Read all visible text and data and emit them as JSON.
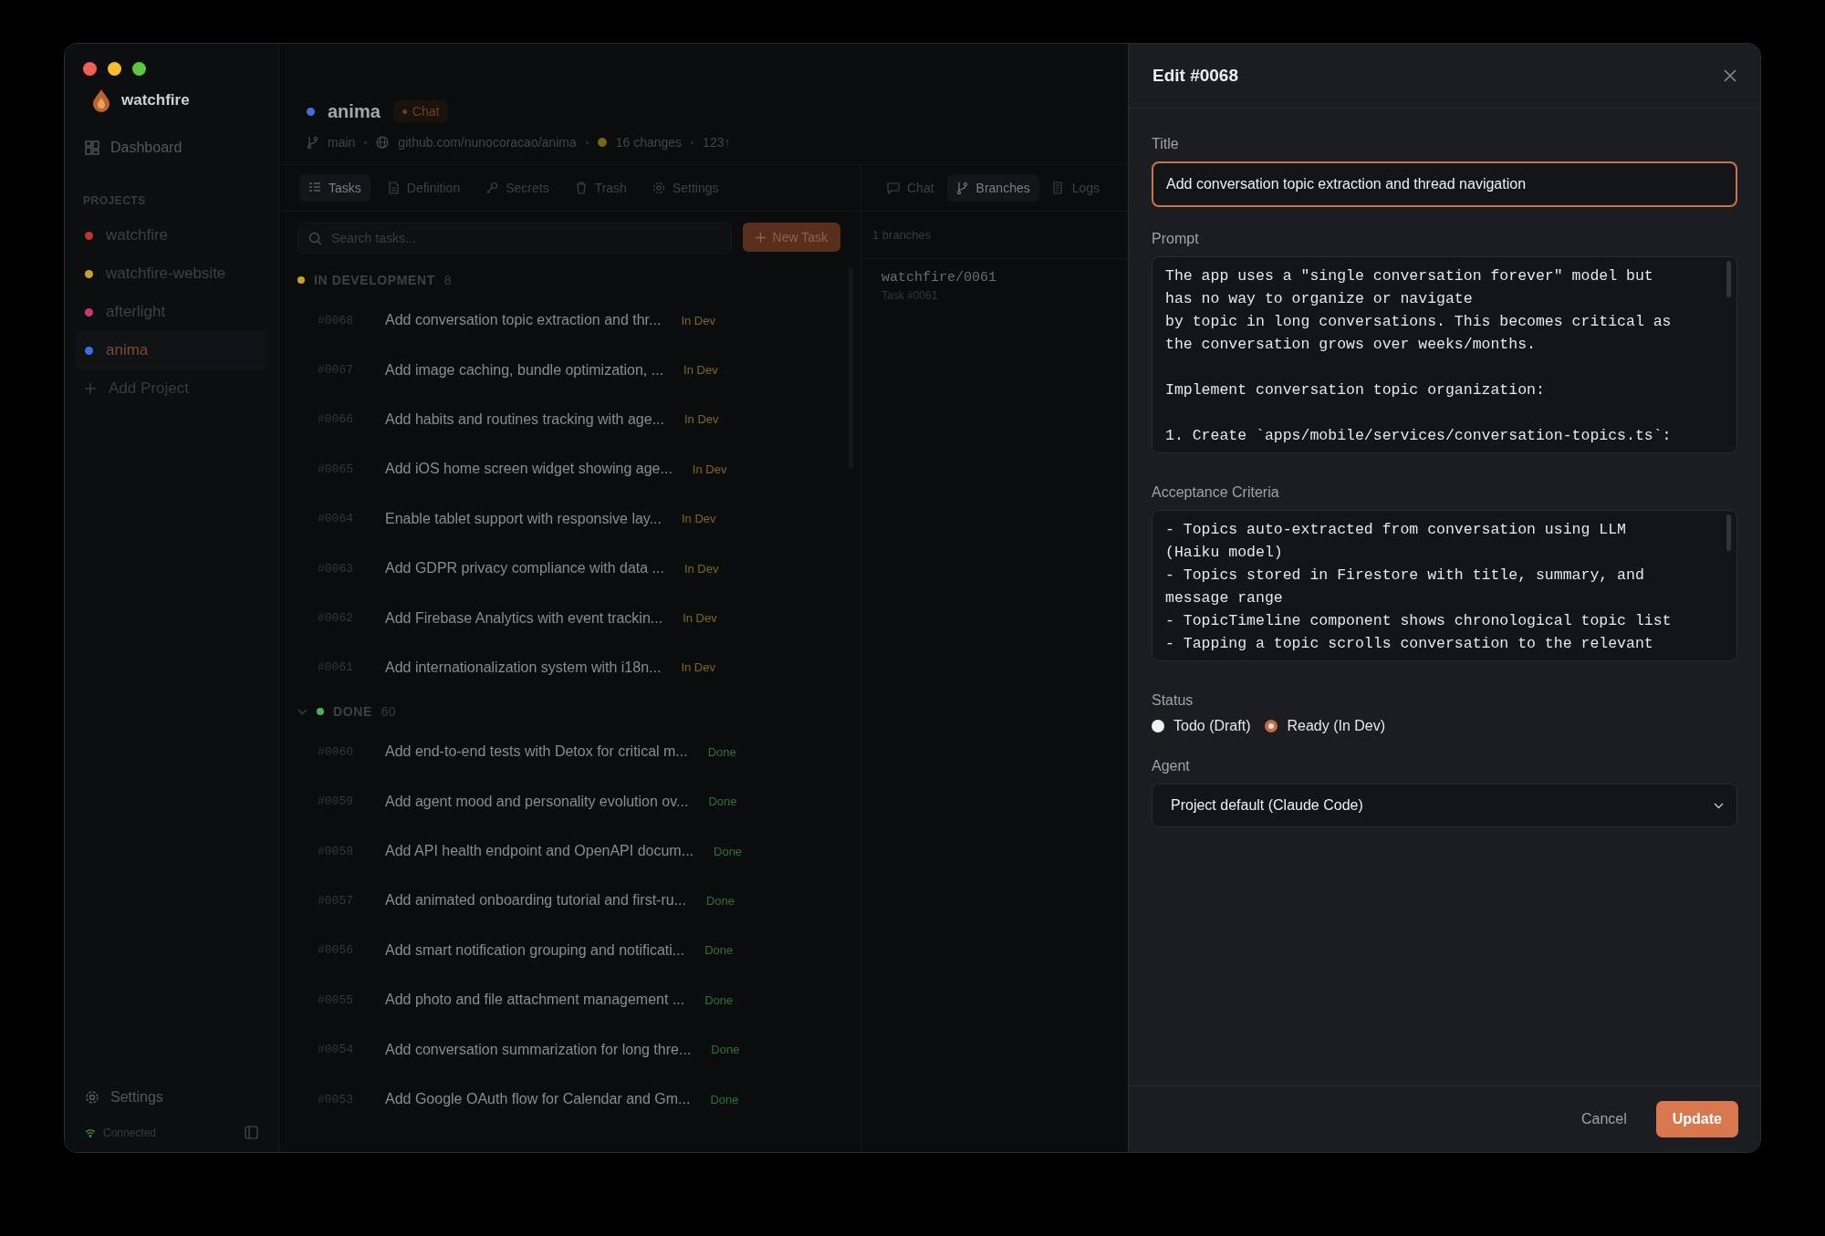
{
  "sidebar": {
    "app_name": "watchfire",
    "nav": [
      {
        "label": "Dashboard",
        "selected": false
      }
    ],
    "section_label": "PROJECTS",
    "projects": [
      {
        "name": "watchfire",
        "color": "#b8382e",
        "selected": false
      },
      {
        "name": "watchfire-website",
        "color": "#c9a227",
        "selected": false
      },
      {
        "name": "afterlight",
        "color": "#c23a6b",
        "selected": false
      },
      {
        "name": "anima",
        "color": "#3f6fd8",
        "selected": true
      }
    ],
    "add_project": "Add Project",
    "settings": "Settings",
    "connection": "Connected"
  },
  "project_header": {
    "name": "anima",
    "color": "#3f6fd8",
    "badge": "Chat",
    "branch": "main",
    "repo": "github.com/nunocoracao/anima",
    "changes": "16 changes",
    "ahead": "123↑"
  },
  "tabs": [
    {
      "label": "Tasks",
      "kind": "list",
      "selected": true
    },
    {
      "label": "Definition",
      "kind": "doc",
      "selected": false
    },
    {
      "label": "Secrets",
      "kind": "key",
      "selected": false
    },
    {
      "label": "Trash",
      "kind": "trash",
      "selected": false
    },
    {
      "label": "Settings",
      "kind": "gear",
      "selected": false
    }
  ],
  "task_list": {
    "search_placeholder": "Search tasks...",
    "new_task_button": "New Task",
    "groups": [
      {
        "label": "IN DEVELOPMENT",
        "count": "8",
        "color": "#c9a227",
        "collapsible": false,
        "tasks": [
          {
            "id": "#0068",
            "title": "Add conversation topic extraction and thr...",
            "status": "In Dev"
          },
          {
            "id": "#0067",
            "title": "Add image caching, bundle optimization, ...",
            "status": "In Dev"
          },
          {
            "id": "#0066",
            "title": "Add habits and routines tracking with age...",
            "status": "In Dev"
          },
          {
            "id": "#0065",
            "title": "Add iOS home screen widget showing age...",
            "status": "In Dev"
          },
          {
            "id": "#0064",
            "title": "Enable tablet support with responsive lay...",
            "status": "In Dev"
          },
          {
            "id": "#0063",
            "title": "Add GDPR privacy compliance with data ...",
            "status": "In Dev"
          },
          {
            "id": "#0062",
            "title": "Add Firebase Analytics with event trackin...",
            "status": "In Dev"
          },
          {
            "id": "#0061",
            "title": "Add internationalization system with i18n...",
            "status": "In Dev"
          }
        ]
      },
      {
        "label": "DONE",
        "count": "60",
        "color": "#4caf50",
        "collapsible": true,
        "tasks": [
          {
            "id": "#0060",
            "title": "Add end-to-end tests with Detox for critical m...",
            "status": "Done"
          },
          {
            "id": "#0059",
            "title": "Add agent mood and personality evolution ov...",
            "status": "Done"
          },
          {
            "id": "#0058",
            "title": "Add API health endpoint and OpenAPI docum...",
            "status": "Done"
          },
          {
            "id": "#0057",
            "title": "Add animated onboarding tutorial and first-ru...",
            "status": "Done"
          },
          {
            "id": "#0056",
            "title": "Add smart notification grouping and notificati...",
            "status": "Done"
          },
          {
            "id": "#0055",
            "title": "Add photo and file attachment management ...",
            "status": "Done"
          },
          {
            "id": "#0054",
            "title": "Add conversation summarization for long thre...",
            "status": "Done"
          },
          {
            "id": "#0053",
            "title": "Add Google OAuth flow for Calendar and Gm...",
            "status": "Done"
          }
        ]
      }
    ]
  },
  "side_tabs": [
    {
      "label": "Chat",
      "kind": "chat",
      "selected": false
    },
    {
      "label": "Branches",
      "kind": "branch",
      "selected": true
    },
    {
      "label": "Logs",
      "kind": "log",
      "selected": false
    }
  ],
  "branches": {
    "count_label": "1 branches",
    "items": [
      {
        "name": "watchfire/0061",
        "task": "Task #0061"
      }
    ]
  },
  "edit_dialog": {
    "title": "Edit #0068",
    "title_label": "Title",
    "title_value": "Add conversation topic extraction and thread navigation",
    "prompt_label": "Prompt",
    "prompt_value": "The app uses a \"single conversation forever\" model but\nhas no way to organize or navigate\nby topic in long conversations. This becomes critical as\nthe conversation grows over weeks/months.\n\nImplement conversation topic organization:\n\n1. Create `apps/mobile/services/conversation-topics.ts`:",
    "criteria_label": "Acceptance Criteria",
    "criteria_value": "- Topics auto-extracted from conversation using LLM\n(Haiku model)\n- Topics stored in Firestore with title, summary, and\nmessage range\n- TopicTimeline component shows chronological topic list\n- Tapping a topic scrolls conversation to the relevant",
    "status_label": "Status",
    "status_options": [
      {
        "label": "Todo (Draft)",
        "selected": false
      },
      {
        "label": "Ready (In Dev)",
        "selected": true
      }
    ],
    "agent_label": "Agent",
    "agent_value": "Project default (Claude Code)",
    "cancel": "Cancel",
    "update": "Update"
  }
}
